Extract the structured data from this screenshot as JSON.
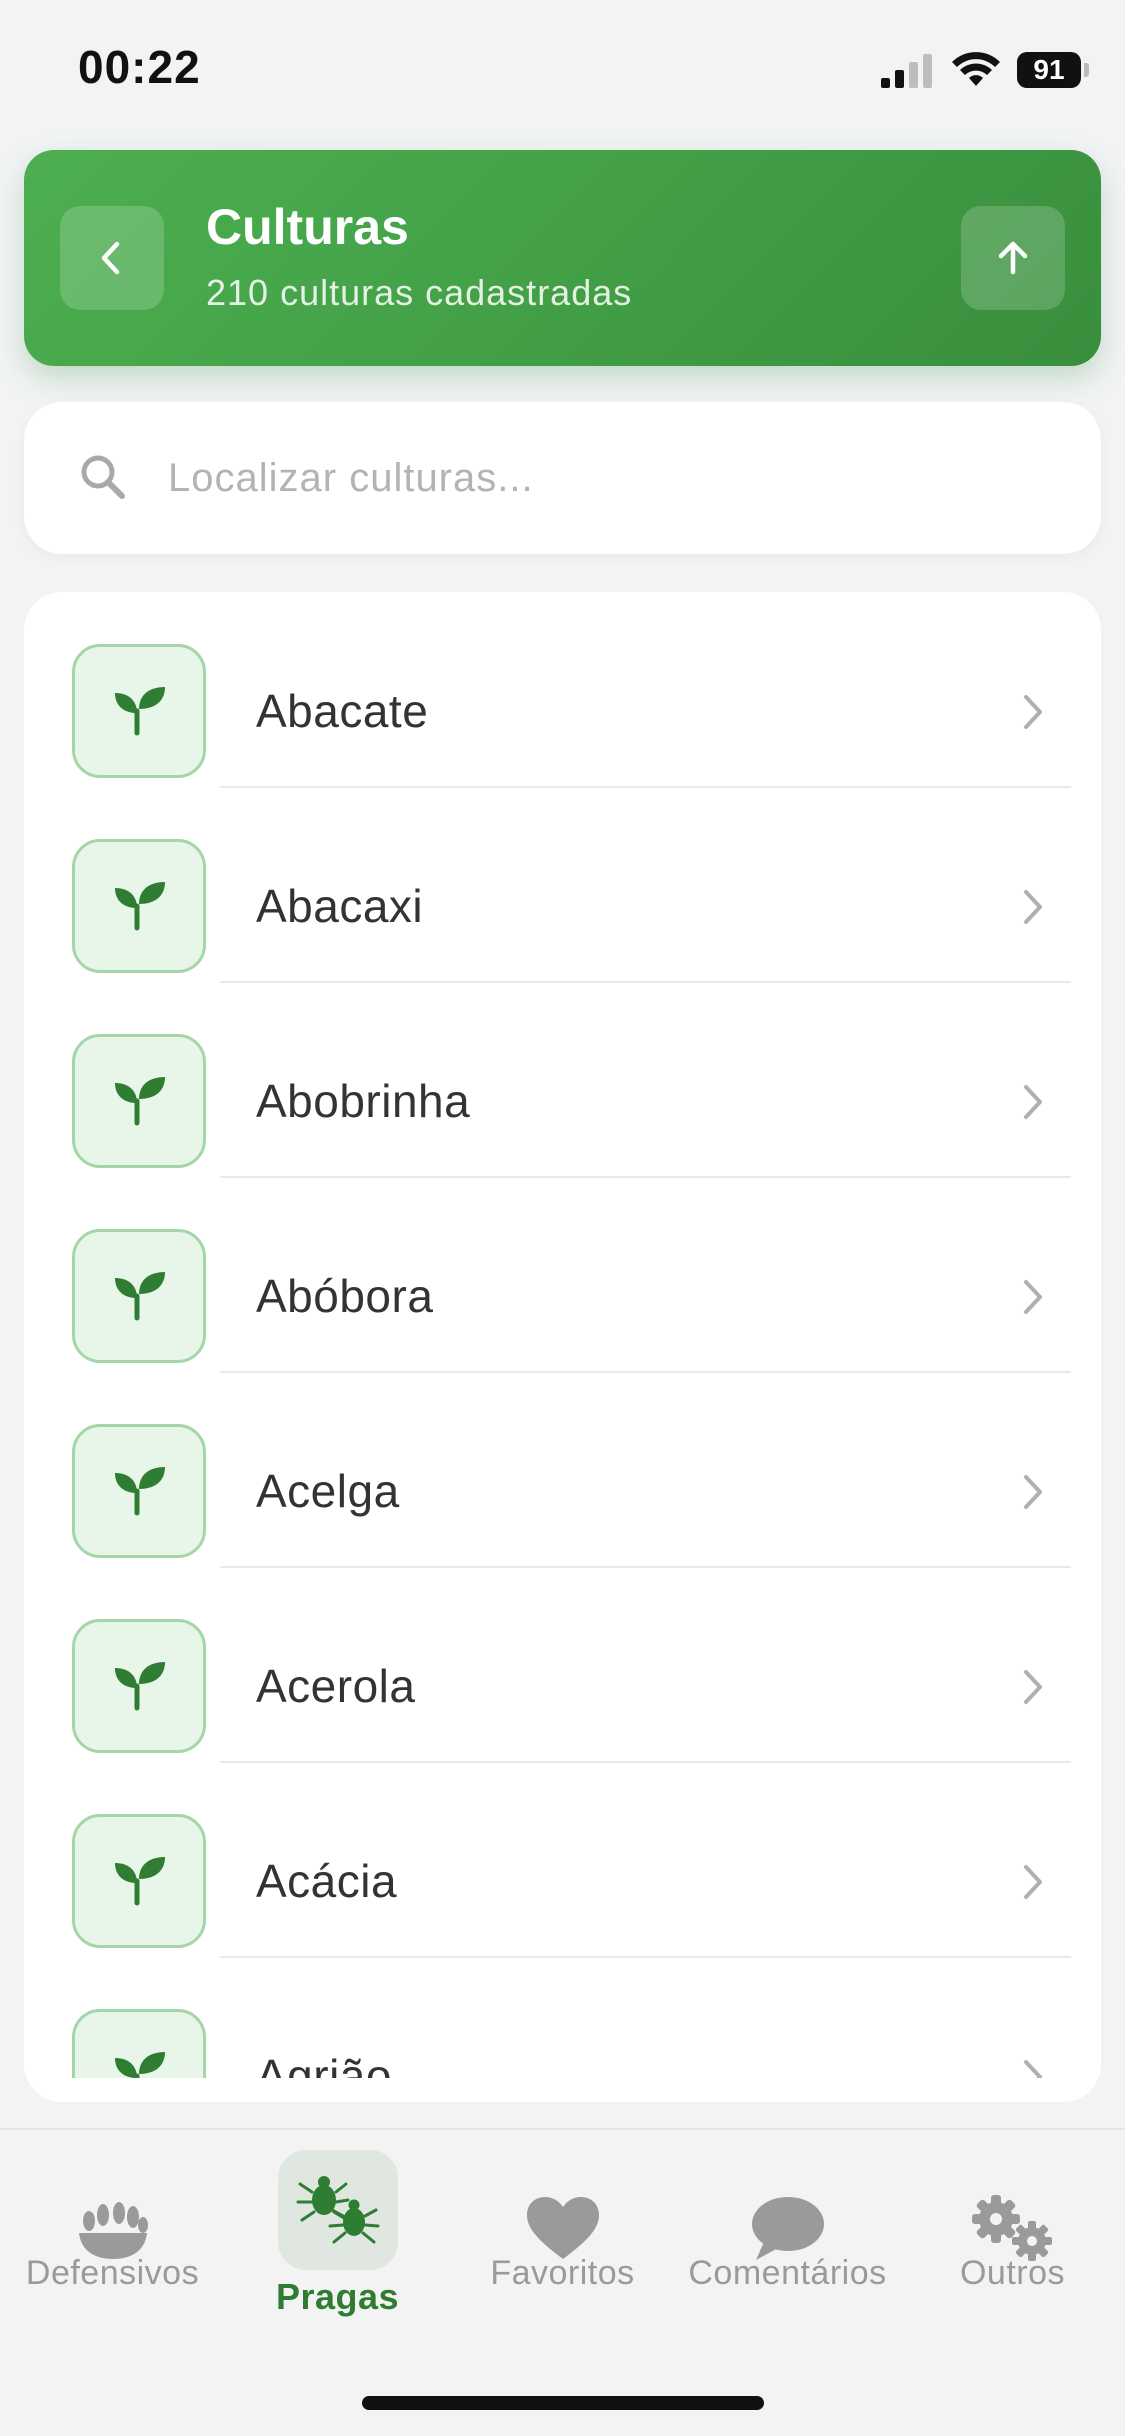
{
  "status_bar": {
    "time": "00:22",
    "battery": "91",
    "icons": [
      "signal-icon",
      "wifi-icon",
      "battery-icon"
    ]
  },
  "header": {
    "title": "Culturas",
    "subtitle": "210 culturas cadastradas",
    "back_icon": "chevron-left-icon",
    "up_icon": "arrow-up-icon"
  },
  "search": {
    "placeholder": "Localizar culturas...",
    "value": ""
  },
  "list": {
    "items": [
      {
        "label": "Abacate"
      },
      {
        "label": "Abacaxi"
      },
      {
        "label": "Abobrinha"
      },
      {
        "label": "Abóbora"
      },
      {
        "label": "Acelga"
      },
      {
        "label": "Acerola"
      },
      {
        "label": "Acácia"
      },
      {
        "label": "Agrião"
      }
    ],
    "item_icon": "seedling-icon"
  },
  "bottom_nav": {
    "items": [
      {
        "label": "Defensivos",
        "icon": "grain-icon",
        "active": false
      },
      {
        "label": "Pragas",
        "icon": "bugs-icon",
        "active": true
      },
      {
        "label": "Favoritos",
        "icon": "heart-icon",
        "active": false
      },
      {
        "label": "Comentários",
        "icon": "chat-bubble-icon",
        "active": false
      },
      {
        "label": "Outros",
        "icon": "gears-icon",
        "active": false
      }
    ]
  },
  "colors": {
    "primary_green": "#43a047",
    "dark_green": "#2e7d32",
    "light_green_bg": "#e8f5e9",
    "inactive_gray": "#9a9a9a"
  }
}
